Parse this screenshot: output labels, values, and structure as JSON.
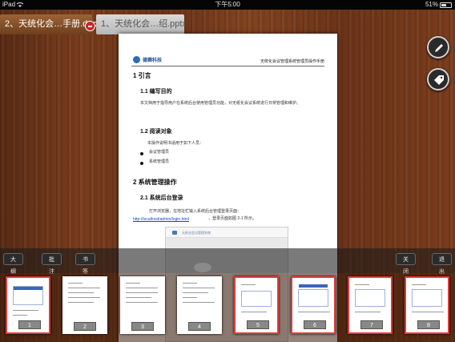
{
  "status": {
    "device": "iPad",
    "time": "下午5:00",
    "battery": "51%",
    "battery_level": 0.51
  },
  "tabs": [
    {
      "label": "2、天统化会…手册.doc",
      "active": true
    },
    {
      "label": "1、天统化会…绍.pptx",
      "active": false
    }
  ],
  "document": {
    "logo": "德赛科技",
    "header_title": "天统化会议管理系统管理员操作手册",
    "h1_intro": "1 引言",
    "h2_purpose": "1.1 编写目的",
    "p_purpose": "本文档用于指导用户在系统后台使用管理员功能，对无纸化会议系统进行日常管理和维护。",
    "h2_readers": "1.2 阅读对象",
    "p_readers": "本操作说明书适用于如下人员：",
    "bullets": [
      "会议管理员",
      "系统管理员"
    ],
    "h1_ops": "2 系统管理操作",
    "h2_login": "2.1 系统后台登录",
    "p_login": "打开浏览器，在地址栏输入系统后台管理登录页面：",
    "login_link": "http://localhost/admin/login.html",
    "p_login2": "，登录页面如图 2-1 所示。",
    "shot_title": "无纸化会议管理系统"
  },
  "bottom_buttons": {
    "outline": "大纲",
    "annotations": "批注",
    "bookmarks": "书签",
    "close": "关闭",
    "exit": "退出"
  },
  "thumbnails": [
    "1",
    "2",
    "3",
    "4",
    "5",
    "6",
    "7",
    "8"
  ],
  "colors": {
    "accent_selected": "#e23c3c",
    "tab_active": "#8a552d",
    "link": "#1a45c8"
  }
}
